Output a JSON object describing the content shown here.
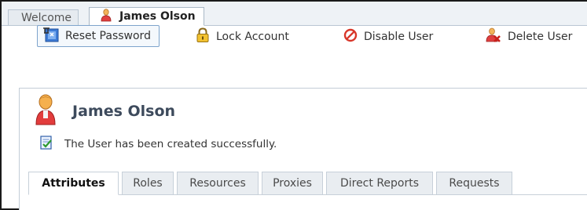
{
  "top_tabs": [
    {
      "label": "Welcome"
    },
    {
      "label": "James Olson"
    }
  ],
  "toolbar": {
    "reset_password": "Reset Password",
    "lock_account": "Lock Account",
    "disable_user": "Disable User",
    "delete_user": "Delete User"
  },
  "page": {
    "title": "James Olson",
    "message": "The User has been created successfully."
  },
  "sub_tabs": [
    {
      "label": "Attributes",
      "active": true
    },
    {
      "label": "Roles"
    },
    {
      "label": "Resources"
    },
    {
      "label": "Proxies"
    },
    {
      "label": "Direct Reports"
    },
    {
      "label": "Requests"
    }
  ],
  "colors": {
    "accent_border": "#7ea4cc",
    "title_text": "#3d4a5c",
    "tab_bg": "#e9edf1"
  },
  "icons": {
    "user": "person-icon",
    "reset": "reset-password-icon",
    "lock": "padlock-icon",
    "disable": "prohibited-icon",
    "delete": "delete-user-icon",
    "success": "checked-document-icon"
  }
}
